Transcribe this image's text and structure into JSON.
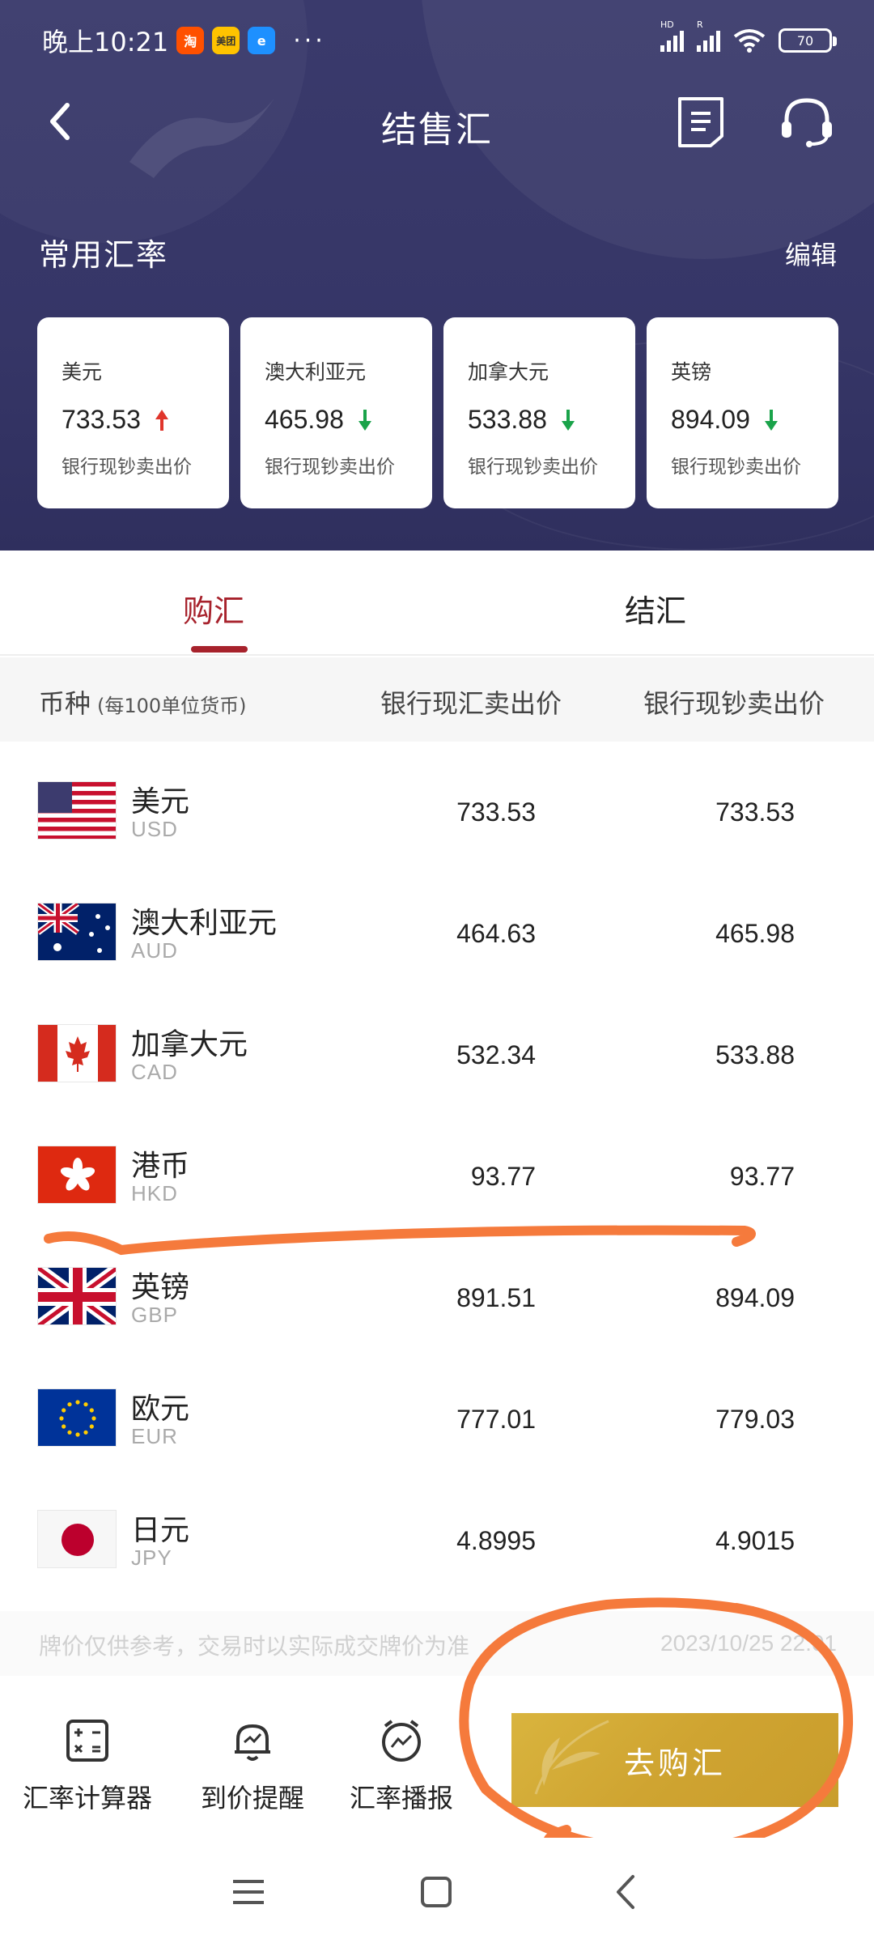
{
  "status_bar": {
    "time": "晚上10:21",
    "apps": [
      {
        "label": "淘",
        "color": "#ff5000"
      },
      {
        "label": "美团",
        "color": "#ffc300"
      },
      {
        "label": "e",
        "color": "#1e90ff"
      }
    ],
    "dots": "···",
    "signal1_tag": "HD",
    "signal2_tag": "R",
    "battery": "70"
  },
  "header": {
    "title": "结售汇",
    "section_title": "常用汇率",
    "edit_label": "编辑"
  },
  "rate_cards": [
    {
      "name": "美元",
      "value": "733.53",
      "trend": "up",
      "sub": "银行现钞卖出价"
    },
    {
      "name": "澳大利亚元",
      "value": "465.98",
      "trend": "down",
      "sub": "银行现钞卖出价"
    },
    {
      "name": "加拿大元",
      "value": "533.88",
      "trend": "down",
      "sub": "银行现钞卖出价"
    },
    {
      "name": "英镑",
      "value": "894.09",
      "trend": "down",
      "sub": "银行现钞卖出价"
    }
  ],
  "tabs": [
    {
      "label": "购汇",
      "active": true
    },
    {
      "label": "结汇",
      "active": false
    }
  ],
  "table": {
    "col_currency": "币种",
    "col_currency_note": "(每100单位货币)",
    "col_1": "银行现汇卖出价",
    "col_2": "银行现钞卖出价",
    "rows": [
      {
        "name": "美元",
        "code": "USD",
        "spot": "733.53",
        "cash": "733.53"
      },
      {
        "name": "澳大利亚元",
        "code": "AUD",
        "spot": "464.63",
        "cash": "465.98"
      },
      {
        "name": "加拿大元",
        "code": "CAD",
        "spot": "532.34",
        "cash": "533.88"
      },
      {
        "name": "港币",
        "code": "HKD",
        "spot": "93.77",
        "cash": "93.77"
      },
      {
        "name": "英镑",
        "code": "GBP",
        "spot": "891.51",
        "cash": "894.09"
      },
      {
        "name": "欧元",
        "code": "EUR",
        "spot": "777.01",
        "cash": "779.03"
      },
      {
        "name": "日元",
        "code": "JPY",
        "spot": "4.8995",
        "cash": "4.9015"
      }
    ]
  },
  "disclaimer": {
    "text": "牌价仅供参考，交易时以实际成交牌价为准",
    "timestamp": "2023/10/25 22:01"
  },
  "toolbar": {
    "calculator": "汇率计算器",
    "alert": "到价提醒",
    "broadcast": "汇率播报",
    "go_button": "去购汇"
  },
  "colors": {
    "header_bg": "#363667",
    "accent_red": "#a7222c",
    "up_red": "#e0352b",
    "down_green": "#1aa34a",
    "gold": "#cfa431",
    "annotation_orange": "#f57a3c"
  }
}
